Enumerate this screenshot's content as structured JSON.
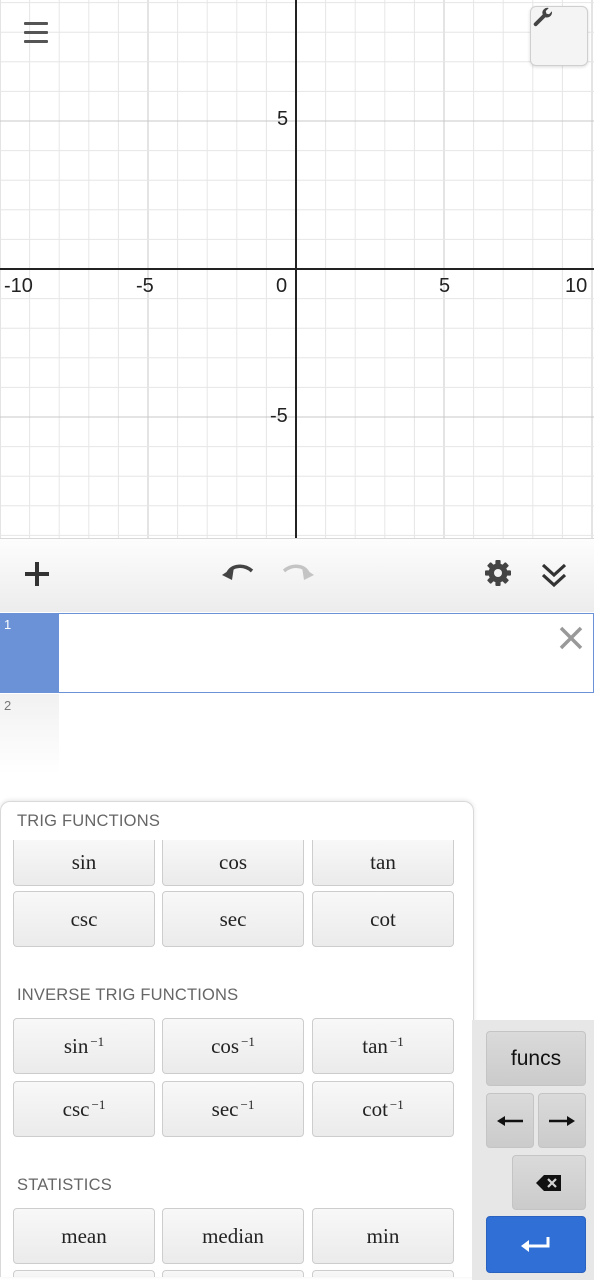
{
  "graph": {
    "x_tick_labels": [
      "-10",
      "-5",
      "0",
      "5",
      "10"
    ],
    "y_tick_labels": [
      "5",
      "-5"
    ],
    "icons": {
      "menu": "hamburger-menu-icon",
      "settings": "wrench-icon"
    }
  },
  "toolbar": {
    "icons": {
      "add": "plus-icon",
      "undo": "undo-icon",
      "redo": "redo-icon",
      "settings": "gear-icon",
      "collapse": "double-chevron-down-icon"
    }
  },
  "expressions": {
    "rows": [
      {
        "index": "1",
        "value": ""
      },
      {
        "index": "2",
        "value": ""
      }
    ]
  },
  "func_panel": {
    "sections": [
      {
        "heading": "TRIG FUNCTIONS",
        "keys": [
          "sin",
          "cos",
          "tan",
          "csc",
          "sec",
          "cot"
        ]
      },
      {
        "heading": "INVERSE TRIG FUNCTIONS",
        "keys": [
          "sin",
          "cos",
          "tan",
          "csc",
          "sec",
          "cot"
        ],
        "superscript": "−1"
      },
      {
        "heading": "STATISTICS",
        "keys": [
          "mean",
          "median",
          "min"
        ]
      }
    ]
  },
  "keypad": {
    "funcs_label": "funcs",
    "icons": {
      "left": "arrow-left-icon",
      "right": "arrow-right-icon",
      "backspace": "backspace-icon",
      "enter": "enter-icon"
    },
    "colors": {
      "enter": "#2f6fd6"
    }
  },
  "colors": {
    "accent": "#6b91d6",
    "axis": "#222222",
    "grid_major": "#c8c8c8",
    "grid_minor": "#e6e6e6"
  }
}
